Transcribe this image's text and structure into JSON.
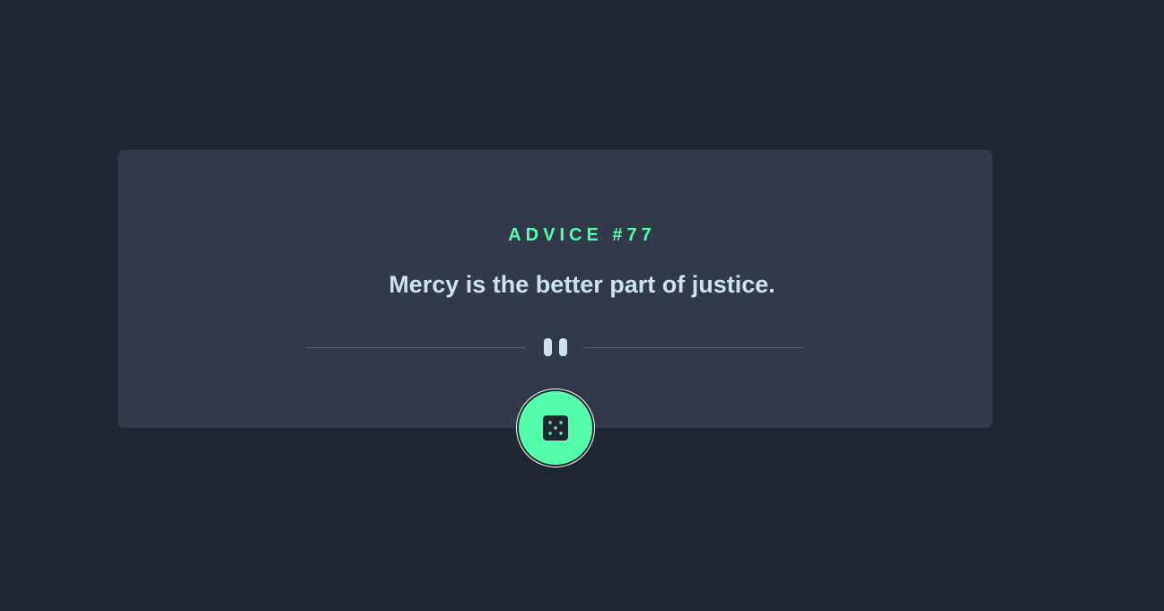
{
  "advice": {
    "label": "ADVICE",
    "number": "#77",
    "text": "Mercy is the better part of justice."
  },
  "icons": {
    "divider": "pause-icon",
    "button": "dice-icon"
  },
  "colors": {
    "background": "#202632",
    "card": "#323a49",
    "accent": "#53ffaa",
    "text": "#cee3e9",
    "divider": "#4f5d74"
  }
}
